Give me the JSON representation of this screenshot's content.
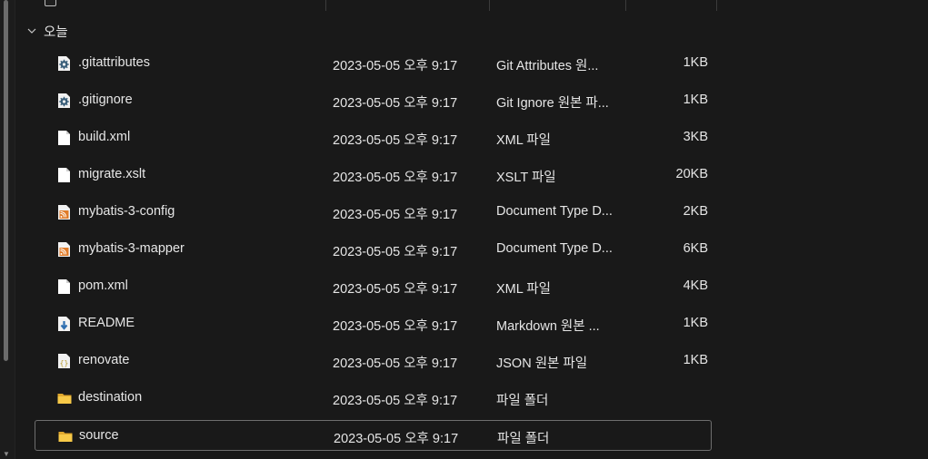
{
  "group": {
    "label": "오늘"
  },
  "rows": [
    {
      "name": ".gitattributes",
      "date": "2023-05-05 오후 9:17",
      "type": "Git Attributes 원...",
      "size": "1KB",
      "icon": "gear-file-icon"
    },
    {
      "name": ".gitignore",
      "date": "2023-05-05 오후 9:17",
      "type": "Git Ignore 원본 파...",
      "size": "1KB",
      "icon": "gear-file-icon"
    },
    {
      "name": "build.xml",
      "date": "2023-05-05 오후 9:17",
      "type": "XML 파일",
      "size": "3KB",
      "icon": "blank-file-icon"
    },
    {
      "name": "migrate.xslt",
      "date": "2023-05-05 오후 9:17",
      "type": "XSLT 파일",
      "size": "20KB",
      "icon": "blank-file-icon"
    },
    {
      "name": "mybatis-3-config",
      "date": "2023-05-05 오후 9:17",
      "type": "Document Type D...",
      "size": "2KB",
      "icon": "rss-file-icon"
    },
    {
      "name": "mybatis-3-mapper",
      "date": "2023-05-05 오후 9:17",
      "type": "Document Type D...",
      "size": "6KB",
      "icon": "rss-file-icon"
    },
    {
      "name": "pom.xml",
      "date": "2023-05-05 오후 9:17",
      "type": "XML 파일",
      "size": "4KB",
      "icon": "blank-file-icon"
    },
    {
      "name": "README",
      "date": "2023-05-05 오후 9:17",
      "type": "Markdown 원본 ...",
      "size": "1KB",
      "icon": "markdown-file-icon"
    },
    {
      "name": "renovate",
      "date": "2023-05-05 오후 9:17",
      "type": "JSON 원본 파일",
      "size": "1KB",
      "icon": "json-file-icon"
    },
    {
      "name": "destination",
      "date": "2023-05-05 오후 9:17",
      "type": "파일 폴더",
      "size": "",
      "icon": "folder-icon"
    },
    {
      "name": "source",
      "date": "2023-05-05 오후 9:17",
      "type": "파일 폴더",
      "size": "",
      "icon": "folder-icon",
      "selected": true
    }
  ]
}
